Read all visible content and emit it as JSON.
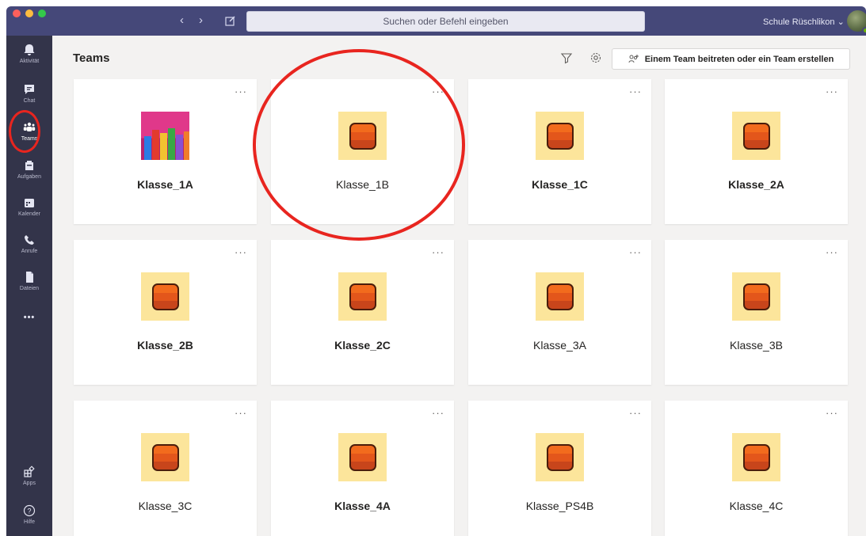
{
  "titlebar": {
    "search_placeholder": "Suchen oder Befehl eingeben",
    "org_name": "Schule Rüschlikon",
    "back_glyph": "‹",
    "forward_glyph": "›",
    "chevron_glyph": "⌄"
  },
  "appbar": {
    "items": [
      {
        "label": "Aktivität",
        "icon": "bell-icon"
      },
      {
        "label": "Chat",
        "icon": "chat-icon"
      },
      {
        "label": "Teams",
        "icon": "teams-icon",
        "active": true
      },
      {
        "label": "Aufgaben",
        "icon": "assignments-icon"
      },
      {
        "label": "Kalender",
        "icon": "calendar-icon"
      },
      {
        "label": "Anrufe",
        "icon": "phone-icon"
      },
      {
        "label": "Dateien",
        "icon": "files-icon"
      },
      {
        "label": "Apps",
        "icon": "apps-icon"
      },
      {
        "label": "Hilfe",
        "icon": "help-icon"
      }
    ],
    "more_glyph": "•••"
  },
  "header": {
    "title": "Teams",
    "join_button": "Einem Team beitreten oder ein Team erstellen"
  },
  "cards": [
    {
      "name": "Klasse_1A",
      "bold": true,
      "logo": "pencils"
    },
    {
      "name": "Klasse_1B",
      "bold": false,
      "logo": "cube"
    },
    {
      "name": "Klasse_1C",
      "bold": true,
      "logo": "cube"
    },
    {
      "name": "Klasse_2A",
      "bold": true,
      "logo": "cube"
    },
    {
      "name": "Klasse_2B",
      "bold": true,
      "logo": "cube"
    },
    {
      "name": "Klasse_2C",
      "bold": true,
      "logo": "cube"
    },
    {
      "name": "Klasse_3A",
      "bold": false,
      "logo": "cube"
    },
    {
      "name": "Klasse_3B",
      "bold": false,
      "logo": "cube"
    },
    {
      "name": "Klasse_3C",
      "bold": false,
      "logo": "cube"
    },
    {
      "name": "Klasse_4A",
      "bold": true,
      "logo": "cube"
    },
    {
      "name": "Klasse_PS4B",
      "bold": false,
      "logo": "cube"
    },
    {
      "name": "Klasse_4C",
      "bold": false,
      "logo": "cube"
    }
  ],
  "card_more_glyph": "···",
  "colors": {
    "titlebar": "#454879",
    "appbar": "#33344a",
    "highlight": "#e8251f",
    "logo_bg": "#fce59b",
    "logo_cube": "#f26b1d"
  }
}
